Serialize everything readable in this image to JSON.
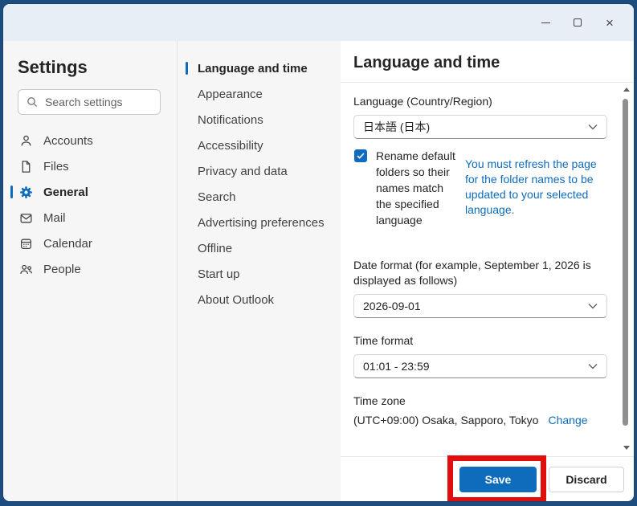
{
  "window": {
    "controls": {
      "minimize": "minimize",
      "maximize": "maximize",
      "close": "close"
    }
  },
  "sidebar": {
    "title": "Settings",
    "search_placeholder": "Search settings",
    "items": [
      {
        "label": "Accounts",
        "icon": "person-icon",
        "selected": false
      },
      {
        "label": "Files",
        "icon": "file-icon",
        "selected": false
      },
      {
        "label": "General",
        "icon": "gear-icon",
        "selected": true
      },
      {
        "label": "Mail",
        "icon": "mail-icon",
        "selected": false
      },
      {
        "label": "Calendar",
        "icon": "calendar-icon",
        "selected": false
      },
      {
        "label": "People",
        "icon": "people-icon",
        "selected": false
      }
    ]
  },
  "nav": {
    "items": [
      {
        "label": "Language and time",
        "selected": true
      },
      {
        "label": "Appearance",
        "selected": false
      },
      {
        "label": "Notifications",
        "selected": false
      },
      {
        "label": "Accessibility",
        "selected": false
      },
      {
        "label": "Privacy and data",
        "selected": false
      },
      {
        "label": "Search",
        "selected": false
      },
      {
        "label": "Advertising preferences",
        "selected": false
      },
      {
        "label": "Offline",
        "selected": false
      },
      {
        "label": "Start up",
        "selected": false
      },
      {
        "label": "About Outlook",
        "selected": false
      }
    ]
  },
  "panel": {
    "title": "Language and time",
    "language": {
      "label": "Language (Country/Region)",
      "value": "日本語 (日本)"
    },
    "rename": {
      "checked": true,
      "checkbox_label": "Rename default folders so their names match the specified language",
      "note": "You must refresh the page for the folder names to be updated to your selected language."
    },
    "date_format": {
      "label": "Date format (for example, September 1, 2026 is displayed as follows)",
      "value": "2026-09-01"
    },
    "time_format": {
      "label": "Time format",
      "value": "01:01 - 23:59"
    },
    "time_zone": {
      "label": "Time zone",
      "value": "(UTC+09:00) Osaka, Sapporo, Tokyo",
      "change_label": "Change"
    },
    "footer": {
      "save_label": "Save",
      "discard_label": "Discard"
    }
  },
  "colors": {
    "accent": "#0f6cbd",
    "annotation_red": "#e10e0e",
    "titlebar": "#e8eef5"
  }
}
